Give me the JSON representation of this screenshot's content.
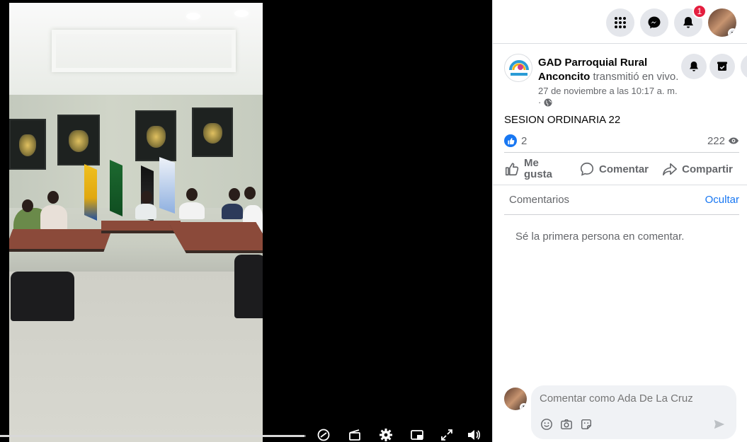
{
  "header": {
    "notifications_badge": "1"
  },
  "post": {
    "page_name": "GAD Parroquial Rural Anconcito",
    "action_text": "transmitió en vivo.",
    "date": "27 de noviembre a las 10:17 a. m.",
    "privacy_sep": "·",
    "text": "SESION ORDINARIA 22",
    "reaction_count": "2",
    "view_count": "222",
    "actions": {
      "like": "Me gusta",
      "comment": "Comentar",
      "share": "Compartir"
    }
  },
  "comments": {
    "tab_label": "Comentarios",
    "hide_label": "Ocultar",
    "empty_text": "Sé la primera persona en comentar.",
    "composer_placeholder": "Comentar como Ada De La Cruz"
  },
  "video": {
    "progress_fraction": 0.995
  },
  "colors": {
    "accent": "#1877f2",
    "badge": "#e41e3f",
    "muted_text": "#65676b",
    "button_bg": "#e4e6eb"
  },
  "icons": [
    "menu-grid-icon",
    "messenger-icon",
    "bell-icon",
    "account-avatar",
    "page-bell-icon",
    "page-save-icon",
    "like-icon",
    "comment-icon",
    "share-icon",
    "eye-icon",
    "globe-icon",
    "emoji-icon",
    "camera-icon",
    "sticker-icon",
    "send-icon",
    "clip-icon",
    "settings-icon",
    "pip-icon",
    "fullscreen-icon",
    "volume-icon",
    "live-chat-icon"
  ]
}
